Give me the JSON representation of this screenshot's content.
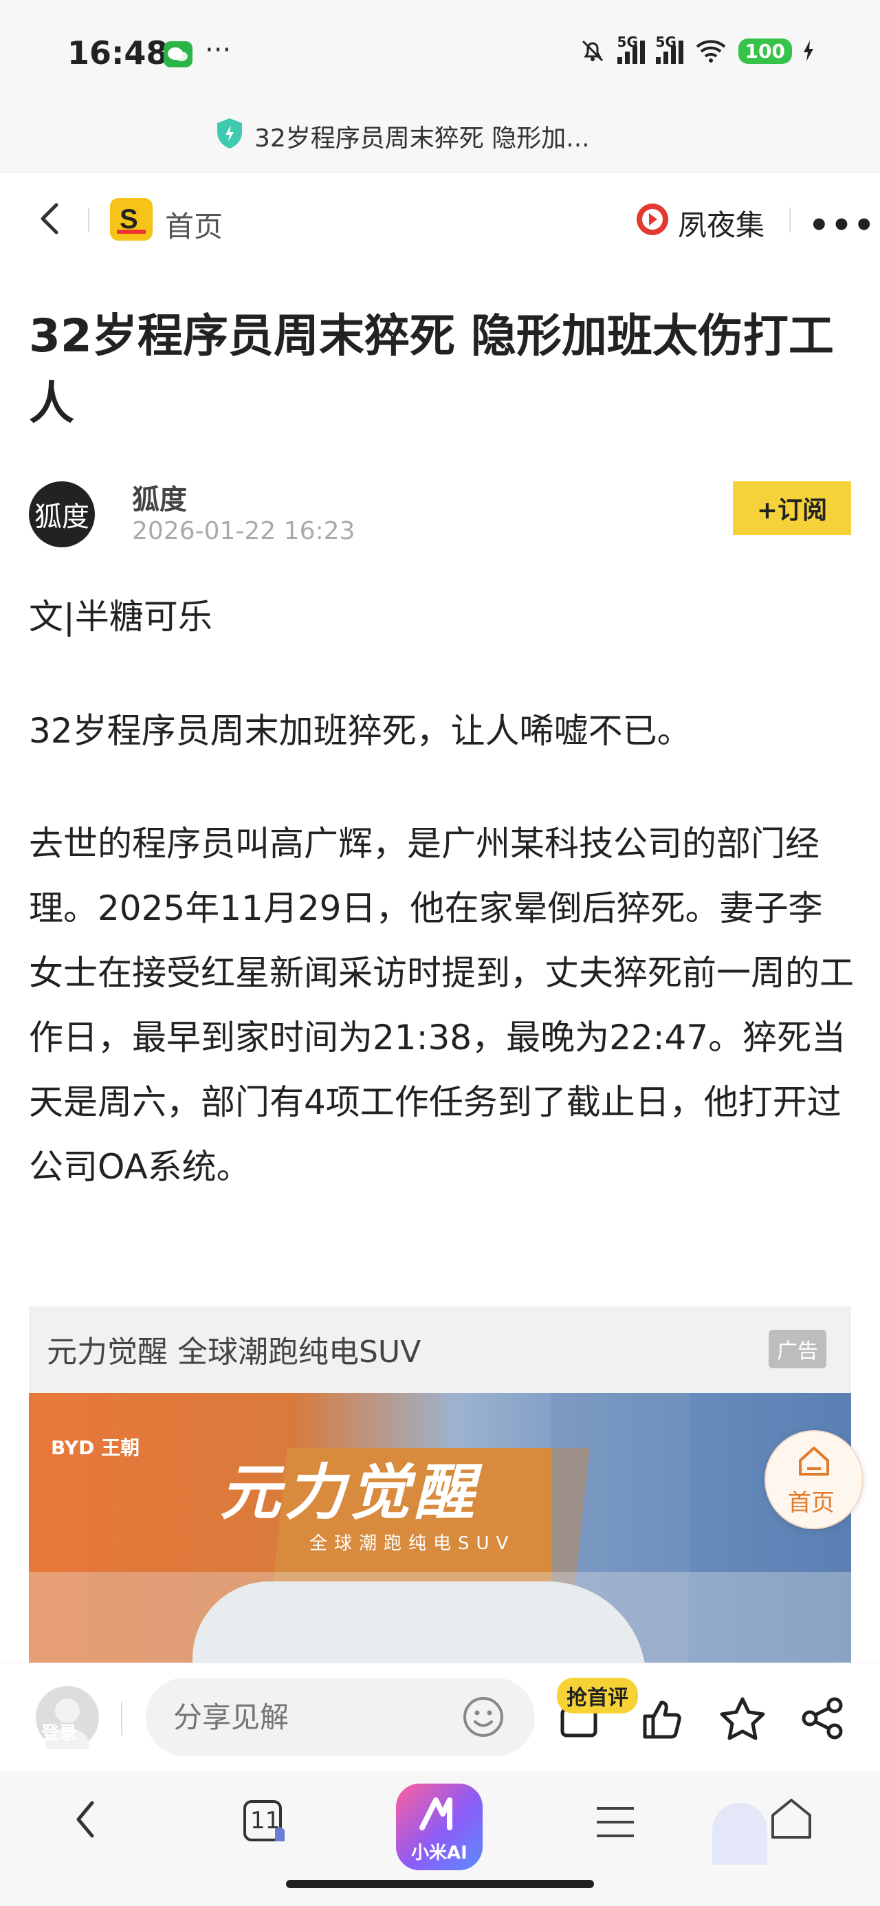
{
  "status_bar": {
    "time": "16:48",
    "network_1": "5G",
    "network_2": "5G",
    "battery": "100"
  },
  "url_bar": {
    "title": "32岁程序员周末猝死 隐形加..."
  },
  "nav": {
    "home_label": "首页",
    "channel_label": "夙夜集"
  },
  "article": {
    "title": "32岁程序员周末猝死 隐形加班太伤打工人",
    "author": "狐度",
    "author_avatar_text": "狐度",
    "date": "2026-01-22 16:23",
    "subscribe_label": "+订阅",
    "byline": "文|半糖可乐",
    "paragraph_1": "32岁程序员周末加班猝死，让人唏嘘不已。",
    "paragraph_2": "去世的程序员叫高广辉，是广州某科技公司的部门经理。2025年11月29日，他在家晕倒后猝死。妻子李女士在接受红星新闻采访时提到，丈夫猝死前一周的工作日，最早到家时间为21:38，最晚为22:47。猝死当天是周六，部门有4项工作任务到了截止日，他打开过公司OA系统。"
  },
  "ad": {
    "title": "元力觉醒 全球潮跑纯电SUV",
    "badge": "广告",
    "tagline": "元力觉醒",
    "subline": "全球潮跑纯电SUV",
    "brand": "BYD 王朝"
  },
  "floating_home": {
    "label": "首页"
  },
  "comment_bar": {
    "login_label": "登录",
    "input_placeholder": "分享见解",
    "first_comment_badge": "抢首评"
  },
  "browser_bar": {
    "tab_count": "11",
    "ai_label": "小米AI"
  }
}
